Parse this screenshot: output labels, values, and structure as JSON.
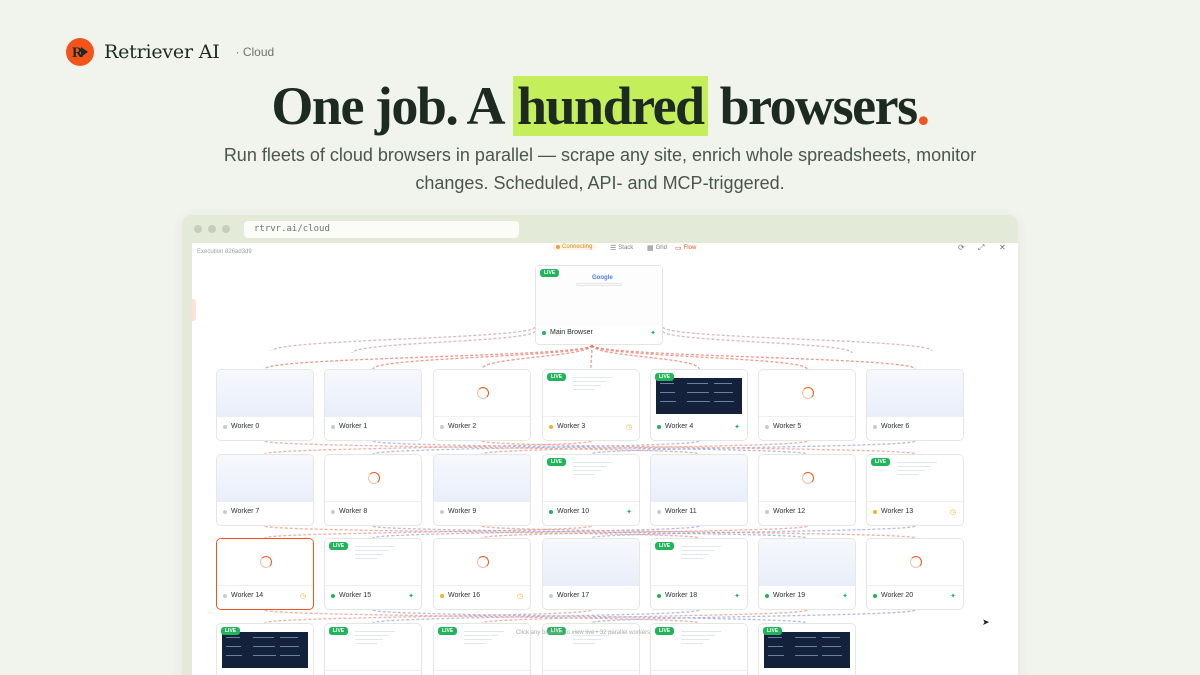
{
  "brand": {
    "name": "Retriever AI",
    "section": "· Cloud",
    "accent": "#f2541b"
  },
  "hero": {
    "pre": "One job. A ",
    "highlight": "hundred",
    "post": " browsers",
    "dot": "."
  },
  "subtitle": "Run fleets of cloud browsers in parallel — scrape any site, enrich whole spreadsheets, monitor changes. Scheduled, API- and MCP-triggered.",
  "browser": {
    "url": "rtrvr.ai/cloud",
    "execution": "Execution 826ad3d9",
    "toolbar": {
      "status": "Connecting",
      "stack": "Stack",
      "grid": "Grid",
      "flow": "Flow"
    },
    "controls": {
      "refresh": "⟳",
      "expand": "⤢",
      "close": "✕"
    },
    "main": {
      "label": "Main Browser",
      "badge": "LIVE",
      "thumb_text": "Google",
      "icon": "sparkle-icon"
    },
    "live_badge": "LIVE",
    "hint": "Click any browser to view live • 32 parallel workers",
    "workers": [
      {
        "label": "Worker 0",
        "thumb": "blank",
        "status": "idle",
        "icon": ""
      },
      {
        "label": "Worker 1",
        "thumb": "blank",
        "status": "idle",
        "icon": ""
      },
      {
        "label": "Worker 2",
        "thumb": "loading",
        "status": "idle",
        "icon": ""
      },
      {
        "label": "Worker 3",
        "thumb": "page",
        "live": true,
        "status": "pending",
        "icon": "clock"
      },
      {
        "label": "Worker 4",
        "thumb": "dark",
        "live": true,
        "status": "running",
        "icon": "sparkle"
      },
      {
        "label": "Worker 5",
        "thumb": "loading",
        "status": "idle",
        "icon": ""
      },
      {
        "label": "Worker 6",
        "thumb": "blank",
        "status": "idle",
        "icon": ""
      },
      {
        "label": "Worker 7",
        "thumb": "blank",
        "status": "idle",
        "icon": ""
      },
      {
        "label": "Worker 8",
        "thumb": "loading",
        "status": "idle",
        "icon": ""
      },
      {
        "label": "Worker 9",
        "thumb": "blank",
        "status": "idle",
        "icon": ""
      },
      {
        "label": "Worker 10",
        "thumb": "page",
        "live": true,
        "status": "running",
        "icon": "sparkle"
      },
      {
        "label": "Worker 11",
        "thumb": "blank",
        "status": "idle",
        "icon": ""
      },
      {
        "label": "Worker 12",
        "thumb": "loading",
        "status": "idle",
        "icon": ""
      },
      {
        "label": "Worker 13",
        "thumb": "page",
        "live": true,
        "status": "pending",
        "icon": "clock"
      },
      {
        "label": "Worker 14",
        "thumb": "loading",
        "status": "idle",
        "icon": "clock",
        "selected": true
      },
      {
        "label": "Worker 15",
        "thumb": "page",
        "live": true,
        "status": "running",
        "icon": "sparkle"
      },
      {
        "label": "Worker 16",
        "thumb": "loading",
        "status": "pending",
        "icon": "clock"
      },
      {
        "label": "Worker 17",
        "thumb": "blank",
        "status": "idle",
        "icon": ""
      },
      {
        "label": "Worker 18",
        "thumb": "page",
        "live": true,
        "status": "running",
        "icon": "sparkle"
      },
      {
        "label": "Worker 19",
        "thumb": "blank",
        "status": "running",
        "icon": "sparkle"
      },
      {
        "label": "Worker 20",
        "thumb": "loading",
        "status": "running",
        "icon": "sparkle"
      },
      {
        "label": "",
        "thumb": "dark",
        "live": true,
        "status": "",
        "icon": ""
      },
      {
        "label": "",
        "thumb": "page",
        "live": true,
        "status": "",
        "icon": ""
      },
      {
        "label": "",
        "thumb": "page",
        "live": true,
        "status": "",
        "icon": ""
      },
      {
        "label": "",
        "thumb": "page",
        "live": true,
        "status": "",
        "icon": ""
      },
      {
        "label": "",
        "thumb": "page",
        "live": true,
        "status": "",
        "icon": ""
      },
      {
        "label": "",
        "thumb": "dark",
        "live": true,
        "status": "",
        "icon": ""
      }
    ]
  }
}
